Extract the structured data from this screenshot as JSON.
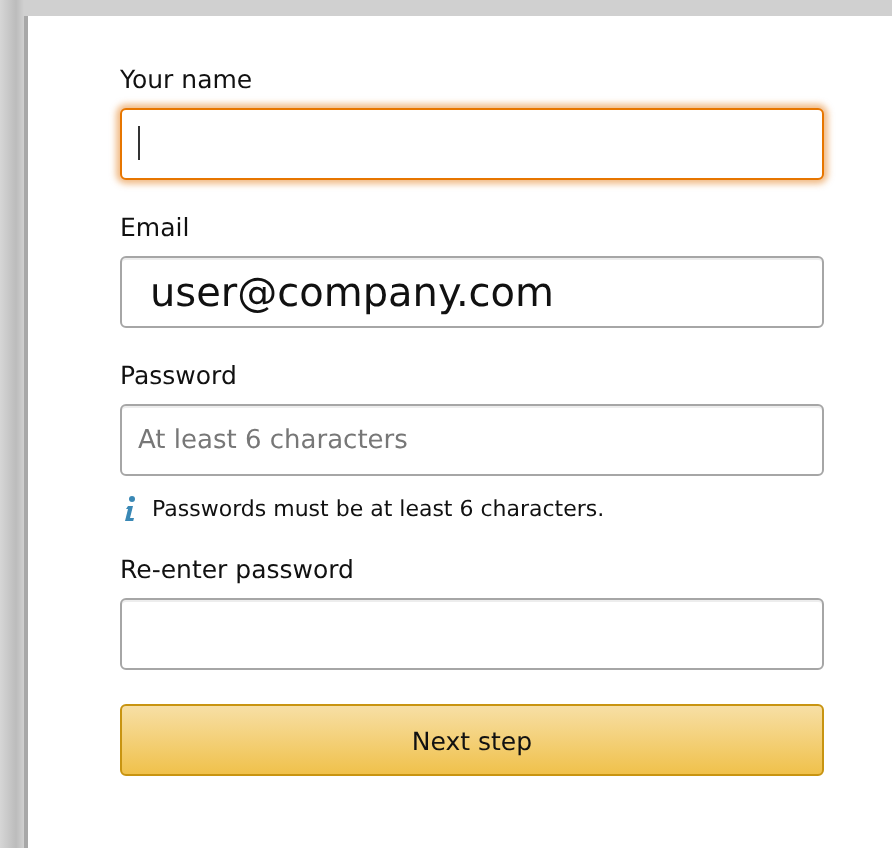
{
  "fields": [
    {
      "label": "Your name",
      "focused": true
    },
    {
      "label": "Email",
      "value": "user@company.com",
      "focused": false
    },
    {
      "label": "Password",
      "placeholder": "At least 6 characters",
      "focused": false,
      "hint": "Passwords must be at least 6 characters."
    },
    {
      "label": "Re-enter password",
      "focused": false
    }
  ],
  "submit_button": "Next step"
}
